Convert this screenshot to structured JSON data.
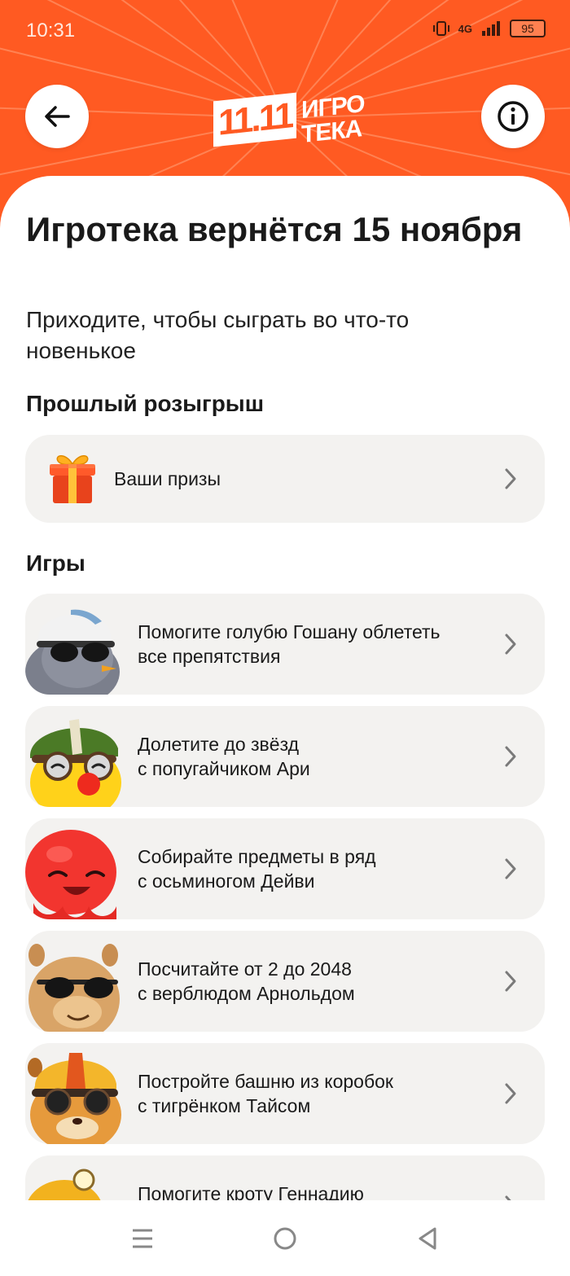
{
  "status_bar": {
    "time": "10:31",
    "network": "4G",
    "battery": "95"
  },
  "header": {
    "logo_number": "11.11",
    "logo_word_line1": "ИГРО",
    "logo_word_line2": "ТЕКА",
    "back_icon": "arrow-left-icon",
    "info_icon": "info-icon",
    "accent_color": "#ff5a22"
  },
  "main": {
    "title": "Игротека вернётся 15 ноября",
    "subtitle": "Приходите, чтобы сыграть во что-то новенькое",
    "past_section_title": "Прошлый розыгрыш",
    "prizes_label": "Ваши призы",
    "games_section_title": "Игры",
    "games": [
      {
        "line1": "Помогите голубю Гошану облететь",
        "line2": "все препятствия",
        "avatar": "pigeon-avatar"
      },
      {
        "line1": "Долетите до звёзд",
        "line2": "с попугайчиком Ари",
        "avatar": "parrot-avatar"
      },
      {
        "line1": "Собирайте предметы в ряд",
        "line2": "с осьминогом Дейви",
        "avatar": "octopus-avatar"
      },
      {
        "line1": "Посчитайте от 2 до 2048",
        "line2": "с верблюдом Арнольдом",
        "avatar": "camel-avatar"
      },
      {
        "line1": "Постройте башню из коробок",
        "line2": "с тигрёнком Тайсом",
        "avatar": "tiger-avatar"
      },
      {
        "line1": "Помогите кроту Геннадию",
        "line2": "",
        "avatar": "mole-avatar"
      }
    ]
  },
  "navbar": {
    "items": [
      "menu-icon",
      "home-icon",
      "back-triangle-icon"
    ]
  }
}
